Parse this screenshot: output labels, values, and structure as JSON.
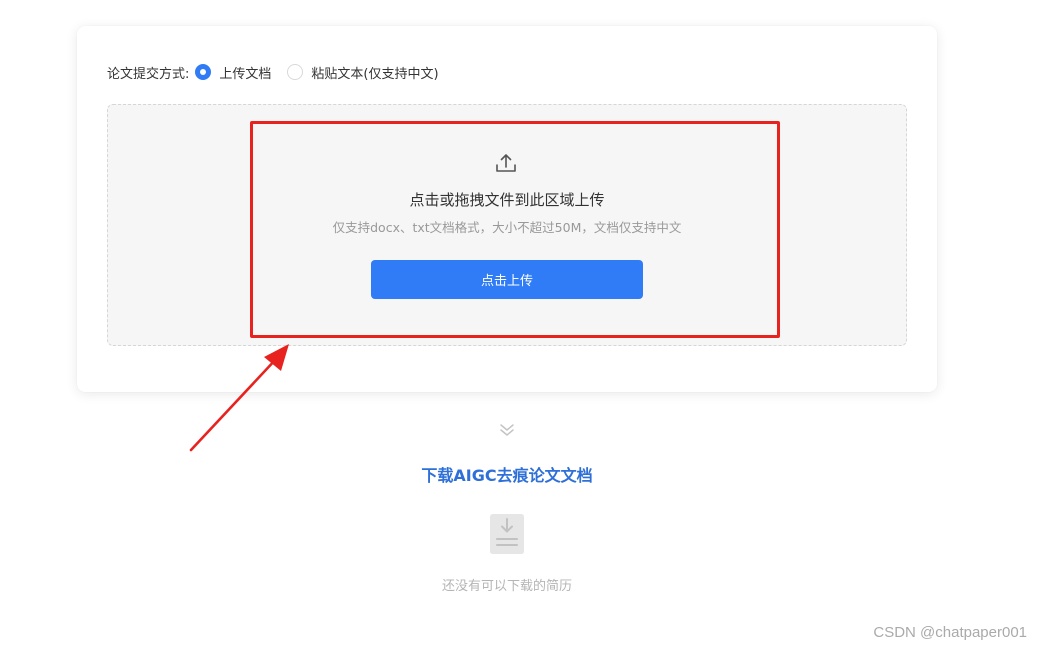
{
  "submission": {
    "mode_label": "论文提交方式:",
    "options": [
      {
        "label": "上传文档",
        "selected": true
      },
      {
        "label": "粘贴文本(仅支持中文)",
        "selected": false
      }
    ]
  },
  "upload": {
    "icon": "upload-icon",
    "title": "点击或拖拽文件到此区域上传",
    "hint": "仅支持docx、txt文档格式，大小不超过50M，文档仅支持中文",
    "button_label": "点击上传"
  },
  "download": {
    "icon": "chevron-down-double-icon",
    "title": "下载AIGC去痕论文文档",
    "empty_icon": "file-download-icon",
    "empty_text": "还没有可以下载的简历"
  },
  "watermark": "CSDN @chatpaper001",
  "colors": {
    "accent": "#2f7cf6",
    "link_title": "#2f6fd8",
    "annotation_red": "#e8231f",
    "dropzone_bg": "#f6f6f6"
  }
}
